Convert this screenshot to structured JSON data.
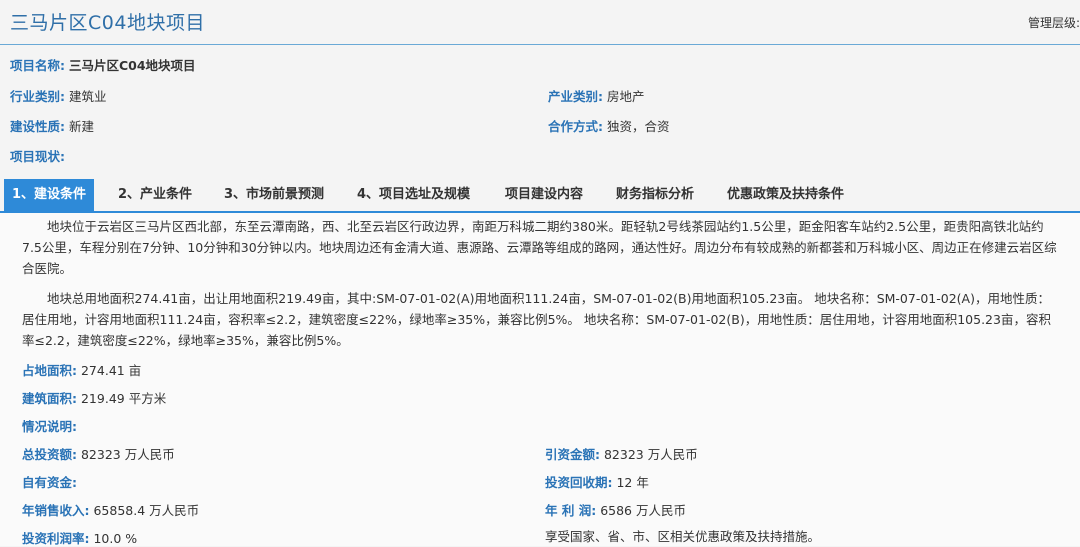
{
  "header": {
    "title": "三马片区C04地块项目",
    "mgmt_label": "管理层级:"
  },
  "info": {
    "name_label": "项目名称:",
    "name_value": "三马片区C04地块项目",
    "industry_label": "行业类别:",
    "industry_value": "建筑业",
    "sector_label": "产业类别:",
    "sector_value": "房地产",
    "nature_label": "建设性质:",
    "nature_value": "新建",
    "coop_label": "合作方式:",
    "coop_value": "独资，合资",
    "status_label": "项目现状:",
    "status_value": ""
  },
  "tabs": [
    {
      "label": "1、建设条件"
    },
    {
      "label": "2、产业条件"
    },
    {
      "label": "3、市场前景预测"
    },
    {
      "label": "4、项目选址及规模"
    },
    {
      "label": "项目建设内容"
    },
    {
      "label": "财务指标分析"
    },
    {
      "label": "优惠政策及扶持条件"
    }
  ],
  "content": {
    "para1": "地块位于云岩区三马片区西北部，东至云潭南路，西、北至云岩区行政边界，南距万科城二期约380米。距轻轨2号线茶园站约1.5公里，距金阳客车站约2.5公里，距贵阳高铁北站约7.5公里，车程分别在7分钟、10分钟和30分钟以内。地块周边还有金清大道、惠源路、云潭路等组成的路网，通达性好。周边分布有较成熟的新都荟和万科城小区、周边正在修建云岩区综合医院。",
    "para2": "地块总用地面积274.41亩，出让用地面积219.49亩，其中:SM-07-01-02(A)用地面积111.24亩，SM-07-01-02(B)用地面积105.23亩。 地块名称：SM-07-01-02(A)，用地性质：居住用地，计容用地面积111.24亩，容积率≤2.2，建筑密度≤22%，绿地率≥35%，兼容比例5%。 地块名称：SM-07-01-02(B)，用地性质：居住用地，计容用地面积105.23亩，容积率≤2.2，建筑密度≤22%，绿地率≥35%，兼容比例5%。",
    "area_label": "占地面积:",
    "area_value": "274.41 亩",
    "build_label": "建筑面积:",
    "build_value": "219.49 平方米",
    "desc_label": "情况说明:",
    "desc_value": "",
    "total_inv_label": "总投资额:",
    "total_inv_value": "82323 万人民币",
    "attract_label": "引资金额:",
    "attract_value": "82323 万人民币",
    "own_label": "自有资金:",
    "own_value": "",
    "payback_label": "投资回收期:",
    "payback_value": "12 年",
    "sales_label": "年销售收入:",
    "sales_value": "65858.4 万人民币",
    "profit_label": "年 利 润:",
    "profit_value": "6586 万人民币",
    "roi_label": "投资利润率:",
    "roi_value": "10.0 %",
    "policy_text": "享受国家、省、市、区相关优惠政策及扶持措施。"
  }
}
